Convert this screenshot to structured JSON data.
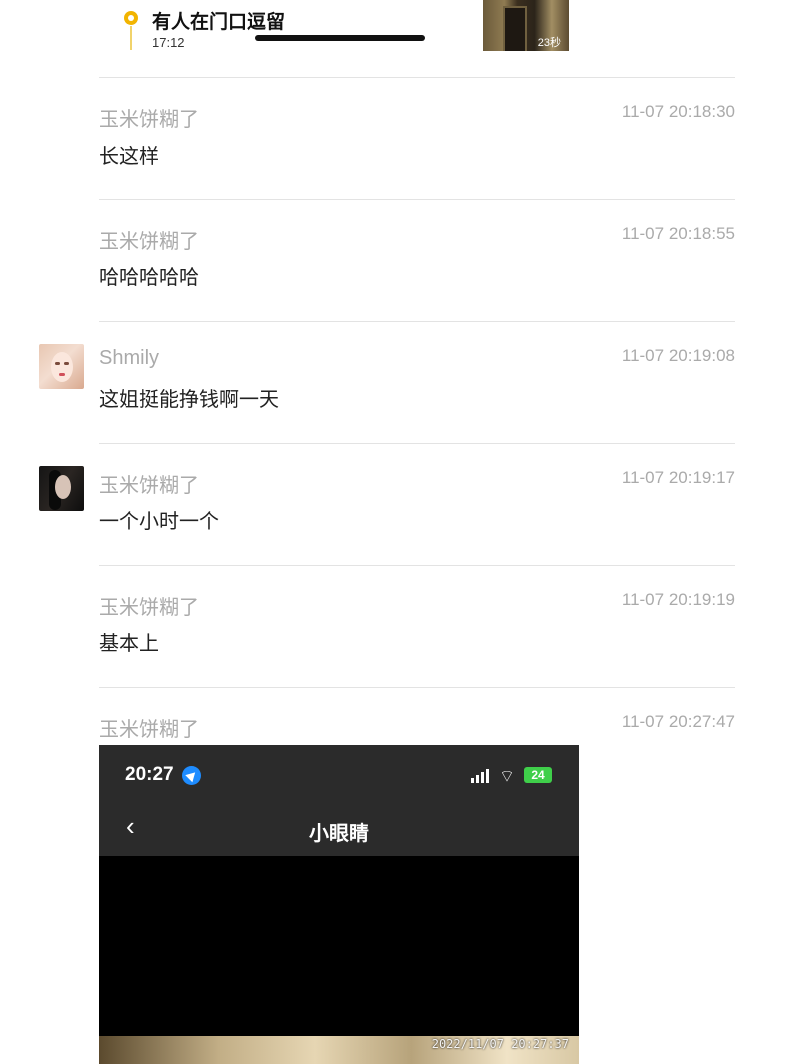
{
  "event_card": {
    "title": "有人在门口逗留",
    "time": "17:12",
    "duration": "23秒"
  },
  "messages": [
    {
      "user": "玉米饼糊了",
      "time": "11-07 20:18:30",
      "text": "长这样",
      "avatar": null
    },
    {
      "user": "玉米饼糊了",
      "time": "11-07 20:18:55",
      "text": "哈哈哈哈哈",
      "avatar": null
    },
    {
      "user": "Shmily",
      "time": "11-07 20:19:08",
      "text": "这姐挺能挣钱啊一天",
      "avatar": "avatar-girl-pink"
    },
    {
      "user": "玉米饼糊了",
      "time": "11-07 20:19:17",
      "text": "一个小时一个",
      "avatar": "avatar-girl-dark"
    },
    {
      "user": "玉米饼糊了",
      "time": "11-07 20:19:19",
      "text": "基本上",
      "avatar": null
    },
    {
      "user": "玉米饼糊了",
      "time": "11-07 20:27:47",
      "text": "",
      "avatar": null
    }
  ],
  "screenshot": {
    "clock": "20:27",
    "battery": "24",
    "back_glyph": "‹",
    "title": "小眼睛",
    "timestamp": "2022/11/07 20:27:37",
    "wifi_glyph": "⌔"
  },
  "colors": {
    "accent": "#f2b400",
    "meta_gray": "#aaaaaa",
    "divider": "#e3e3e3"
  }
}
